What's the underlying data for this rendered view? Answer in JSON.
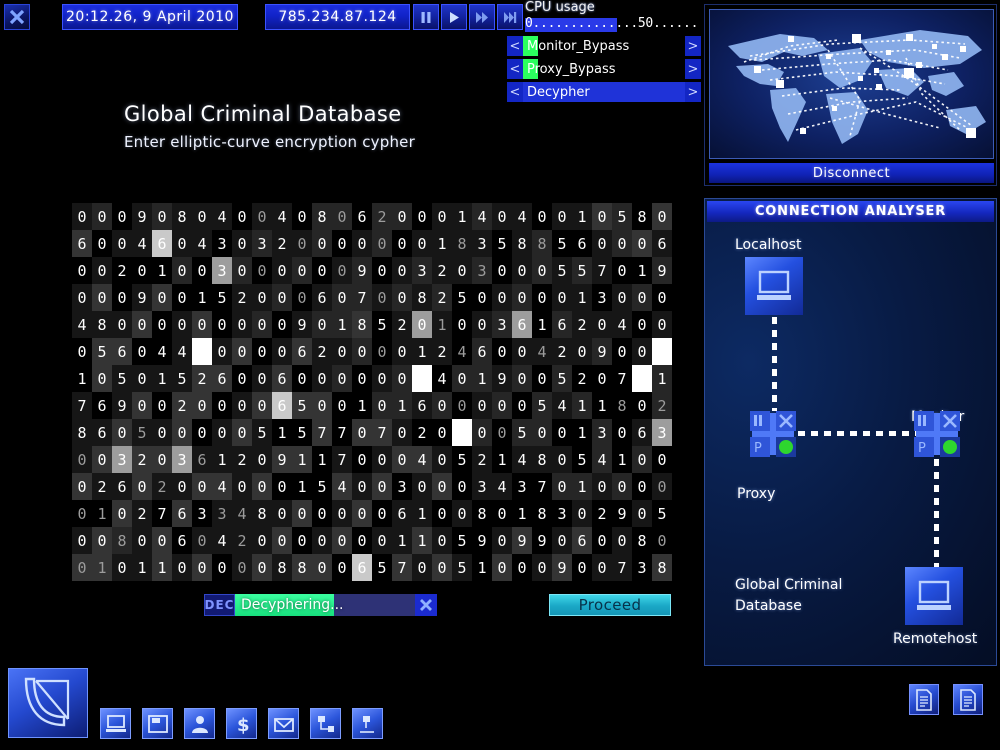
{
  "topbar": {
    "close_icon": "close-icon",
    "clock": "20:12.26, 9 April 2010",
    "ip": "785.234.87.124",
    "transport": [
      {
        "name": "pause-button",
        "glyph": "pause-icon"
      },
      {
        "name": "play-button",
        "glyph": "play-icon"
      },
      {
        "name": "fast-forward-button",
        "glyph": "fast-forward-icon"
      },
      {
        "name": "skip-end-button",
        "glyph": "skip-end-icon"
      }
    ]
  },
  "cpu": {
    "label": "CPU usage",
    "scale": "0..............50..............100",
    "percent": 52,
    "accent": "#2a3ae8"
  },
  "tasks": [
    {
      "label": "Monitor_Bypass",
      "progress": 9,
      "fill_color": "#2bff5e",
      "prev": "<",
      "next": ">"
    },
    {
      "label": "Proxy_Bypass",
      "progress": 9,
      "fill_color": "#2bff5e",
      "prev": "<",
      "next": ">"
    },
    {
      "label": "Decypher",
      "progress": 100,
      "fill_color": "#1f33d8",
      "prev": "<",
      "next": ">"
    }
  ],
  "main": {
    "title": "Global Criminal Database",
    "subtitle": "Enter elliptic-curve encryption cypher"
  },
  "cipher": {
    "columns": 30,
    "rows": [
      "000908040040806200014040010580",
      "600460430320000000183588560006",
      "002010030000009003203000557019",
      "000900152000607008250000013000",
      "480000000009018520100361620400",
      "056044000006200001246004209000",
      "105015260060000000401900520701",
      "769002000065001016000005411802",
      "860500000515770702000050013063",
      "003203612091170004052148054100",
      "026020040001540030003437010000",
      "010276334800000061008018302905",
      "008006042000000011059099060080",
      "010110000088006570051000900738"
    ],
    "shade_legend": [
      "b0",
      "b1",
      "b2",
      "b3"
    ],
    "highlights": [
      {
        "row": 1,
        "col": 4,
        "kind": "hl-l"
      },
      {
        "row": 2,
        "col": 7,
        "kind": "hl-m"
      },
      {
        "row": 4,
        "col": 17,
        "kind": "hl-m"
      },
      {
        "row": 4,
        "col": 22,
        "kind": "hl-m"
      },
      {
        "row": 5,
        "col": 6,
        "kind": "hl-w"
      },
      {
        "row": 5,
        "col": 29,
        "kind": "hl-w"
      },
      {
        "row": 6,
        "col": 17,
        "kind": "hl-w"
      },
      {
        "row": 6,
        "col": 28,
        "kind": "hl-w"
      },
      {
        "row": 7,
        "col": 10,
        "kind": "hl-l"
      },
      {
        "row": 8,
        "col": 19,
        "kind": "hl-w"
      },
      {
        "row": 8,
        "col": 29,
        "kind": "hl-m"
      },
      {
        "row": 9,
        "col": 2,
        "kind": "hl-m"
      },
      {
        "row": 9,
        "col": 5,
        "kind": "hl-m"
      },
      {
        "row": 13,
        "col": 14,
        "kind": "hl-l"
      }
    ]
  },
  "decrypt": {
    "tag": "DEC",
    "status": "Decyphering...",
    "progress": 55,
    "cancel_icon": "close-icon",
    "proceed_label": "Proceed"
  },
  "map": {
    "disconnect_label": "Disconnect",
    "icon": "world-map-icon"
  },
  "analyser": {
    "title": "CONNECTION ANALYSER",
    "nodes": [
      {
        "name": "localhost",
        "label": "Localhost",
        "icon": "computer-icon"
      },
      {
        "name": "proxy",
        "label": "Proxy",
        "icon": "proxy-node-icon",
        "status_color": "#2ed62e"
      },
      {
        "name": "monitor",
        "label": "Monitor",
        "icon": "monitor-node-icon",
        "status_color": "#2ed62e"
      },
      {
        "name": "remotehost",
        "label": "Remotehost",
        "icon": "computer-icon"
      },
      {
        "name": "database",
        "label": "Global Criminal\nDatabase",
        "icon": "none"
      }
    ]
  },
  "taskbar": {
    "active_app_icon": "satellite-dish-icon",
    "tray": [
      {
        "name": "computer-icon"
      },
      {
        "name": "floppy-disk-icon"
      },
      {
        "name": "contacts-icon"
      },
      {
        "name": "finance-icon"
      },
      {
        "name": "mail-icon"
      },
      {
        "name": "network-icon"
      },
      {
        "name": "network-map-icon"
      }
    ],
    "system": [
      {
        "name": "document-icon"
      },
      {
        "name": "document-icon"
      }
    ]
  }
}
